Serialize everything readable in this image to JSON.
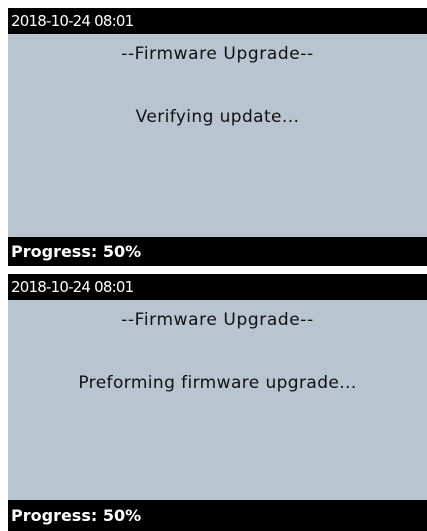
{
  "screens": [
    {
      "timestamp": "2018-10-24 08:01",
      "title": "--Firmware Upgrade--",
      "message": "Verifying update...",
      "progress_label": "Progress: 50%",
      "progress_value": 0.5
    },
    {
      "timestamp": "2018-10-24 08:01",
      "title": "--Firmware Upgrade--",
      "message": "Preforming firmware upgrade...",
      "progress_label": "Progress: 50%",
      "progress_value": 0.5
    }
  ],
  "colors": {
    "screen_background": "#b8c4d0",
    "bar_background": "#000000",
    "bar_text": "#ffffff",
    "body_text": "#111111"
  }
}
